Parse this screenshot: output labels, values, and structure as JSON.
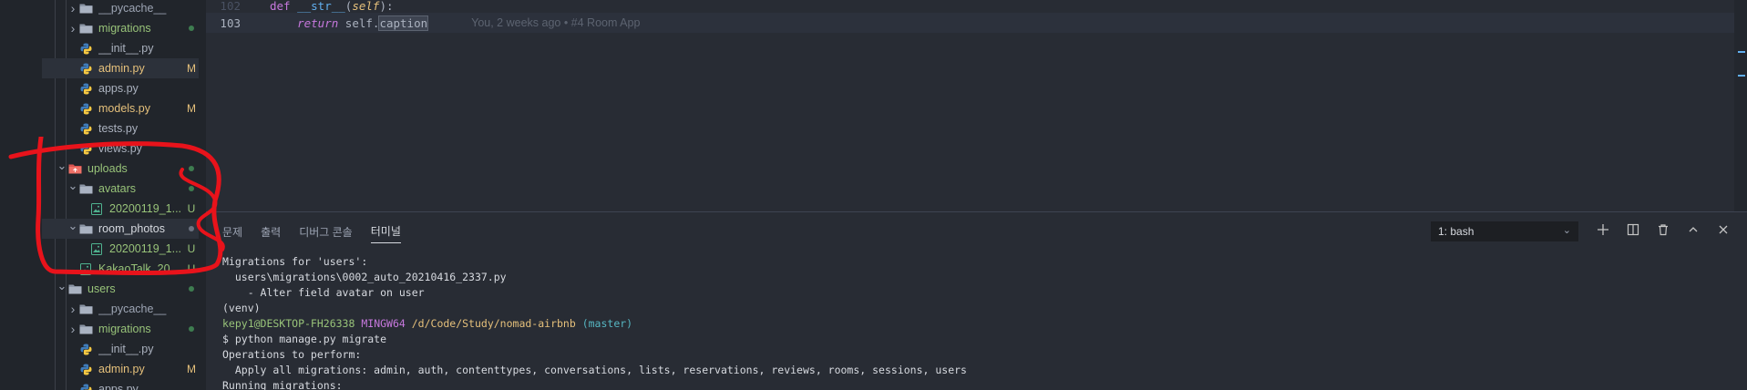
{
  "explorer": {
    "rows": [
      {
        "label": "__pycache__",
        "type": "folder",
        "indent": 2,
        "chevron": "right",
        "color": "#9da5b4",
        "badge": "",
        "dot": ""
      },
      {
        "label": "migrations",
        "type": "folder",
        "indent": 2,
        "chevron": "right",
        "color": "#98c379",
        "badge": "",
        "dot": "#3e7d50"
      },
      {
        "label": "__init__.py",
        "type": "python",
        "indent": 2,
        "chevron": "",
        "color": "#abb2bf",
        "badge": "",
        "dot": ""
      },
      {
        "label": "admin.py",
        "type": "python",
        "indent": 2,
        "chevron": "",
        "color": "#e5c07b",
        "badge": "M",
        "dot": "",
        "selected": true
      },
      {
        "label": "apps.py",
        "type": "python",
        "indent": 2,
        "chevron": "",
        "color": "#abb2bf",
        "badge": "",
        "dot": ""
      },
      {
        "label": "models.py",
        "type": "python",
        "indent": 2,
        "chevron": "",
        "color": "#e5c07b",
        "badge": "M",
        "dot": ""
      },
      {
        "label": "tests.py",
        "type": "python",
        "indent": 2,
        "chevron": "",
        "color": "#abb2bf",
        "badge": "",
        "dot": ""
      },
      {
        "label": "views.py",
        "type": "python",
        "indent": 2,
        "chevron": "",
        "color": "#abb2bf",
        "badge": "",
        "dot": ""
      },
      {
        "label": "uploads",
        "type": "folder-red",
        "indent": 1,
        "chevron": "down",
        "color": "#98c379",
        "badge": "",
        "dot": "#3e7d50"
      },
      {
        "label": "avatars",
        "type": "folder",
        "indent": 2,
        "chevron": "down",
        "color": "#98c379",
        "badge": "",
        "dot": "#3e7d50"
      },
      {
        "label": "20200119_1...",
        "type": "image",
        "indent": 3,
        "chevron": "",
        "color": "#98c379",
        "badge": "U",
        "dot": ""
      },
      {
        "label": "room_photos",
        "type": "folder",
        "indent": 2,
        "chevron": "down",
        "color": "#d7dae0",
        "badge": "",
        "dot": "#6b7280",
        "selected": true
      },
      {
        "label": "20200119_1...",
        "type": "image",
        "indent": 3,
        "chevron": "",
        "color": "#98c379",
        "badge": "U",
        "dot": ""
      },
      {
        "label": "KakaoTalk_20...",
        "type": "image",
        "indent": 2,
        "chevron": "",
        "color": "#98c379",
        "badge": "U",
        "dot": ""
      },
      {
        "label": "users",
        "type": "folder",
        "indent": 1,
        "chevron": "down",
        "color": "#98c379",
        "badge": "",
        "dot": "#3e7d50"
      },
      {
        "label": "__pycache__",
        "type": "folder",
        "indent": 2,
        "chevron": "right",
        "color": "#9da5b4",
        "badge": "",
        "dot": ""
      },
      {
        "label": "migrations",
        "type": "folder",
        "indent": 2,
        "chevron": "right",
        "color": "#98c379",
        "badge": "",
        "dot": "#3e7d50"
      },
      {
        "label": "__init__.py",
        "type": "python",
        "indent": 2,
        "chevron": "",
        "color": "#abb2bf",
        "badge": "",
        "dot": ""
      },
      {
        "label": "admin.py",
        "type": "python",
        "indent": 2,
        "chevron": "",
        "color": "#e5c07b",
        "badge": "M",
        "dot": ""
      },
      {
        "label": "apps.py",
        "type": "python",
        "indent": 2,
        "chevron": "",
        "color": "#abb2bf",
        "badge": "",
        "dot": ""
      }
    ]
  },
  "editor": {
    "line1": {
      "number": "102",
      "kw": "def",
      "fn": "__str__",
      "open": "(",
      "self": "self",
      "close": "):"
    },
    "line2": {
      "number": "103",
      "kw": "return",
      "selfdot": "self.",
      "word": "caption",
      "blame": "You, 2 weeks ago • #4 Room App"
    }
  },
  "panel": {
    "tabs": [
      "문제",
      "출력",
      "디버그 콘솔",
      "터미널"
    ],
    "active_tab": "터미널",
    "terminal_select": "1: bash",
    "actions": [
      "plus-icon",
      "split-icon",
      "trash-icon",
      "chevron-up-icon",
      "close-icon"
    ]
  },
  "terminal": {
    "l1": "Migrations for 'users':",
    "l2": "  users\\migrations\\0002_auto_20210416_2337.py",
    "l3": "    - Alter field avatar on user",
    "l4": "(venv)",
    "l5_user": "kepy1@DESKTOP-FH26338",
    "l5_sys": "MINGW64",
    "l5_path": "/d/Code/Study/nomad-airbnb",
    "l5_branch": "(master)",
    "l6": "$ python manage.py migrate",
    "l7": "Operations to perform:",
    "l8": "  Apply all migrations: admin, auth, contenttypes, conversations, lists, reservations, reviews, rooms, sessions, users",
    "l9": "Running migrations:"
  },
  "colors": {
    "annotation": "#e8131b",
    "modified": "#e5c07b",
    "untracked": "#98c379"
  }
}
